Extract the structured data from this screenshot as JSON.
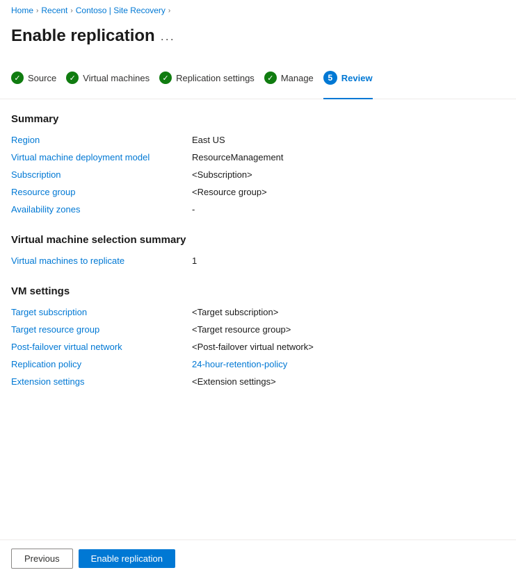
{
  "breadcrumb": {
    "items": [
      {
        "label": "Home",
        "link": true
      },
      {
        "label": "Recent",
        "link": true
      },
      {
        "label": "Contoso | Site Recovery",
        "link": true
      }
    ]
  },
  "page": {
    "title": "Enable replication",
    "dots": "..."
  },
  "steps": [
    {
      "label": "Source",
      "status": "complete",
      "num": 1
    },
    {
      "label": "Virtual machines",
      "status": "complete",
      "num": 2
    },
    {
      "label": "Replication settings",
      "status": "complete",
      "num": 3
    },
    {
      "label": "Manage",
      "status": "complete",
      "num": 4
    },
    {
      "label": "Review",
      "status": "active",
      "num": 5
    }
  ],
  "summary": {
    "title": "Summary",
    "rows": [
      {
        "label": "Region",
        "value": "East US",
        "type": "plain"
      },
      {
        "label": "Virtual machine deployment model",
        "value": "ResourceManagement",
        "type": "plain"
      },
      {
        "label": "Subscription",
        "value": "<Subscription>",
        "type": "plain"
      },
      {
        "label": "Resource group",
        "value": "<Resource group>",
        "type": "plain"
      },
      {
        "label": "Availability zones",
        "value": "-",
        "type": "plain"
      }
    ]
  },
  "vm_selection": {
    "title": "Virtual machine selection summary",
    "rows": [
      {
        "label": "Virtual machines to replicate",
        "value": "1",
        "type": "plain"
      }
    ]
  },
  "vm_settings": {
    "title": "VM settings",
    "rows": [
      {
        "label": "Target subscription",
        "value": "<Target subscription>",
        "type": "plain"
      },
      {
        "label": "Target resource group",
        "value": "<Target resource group>",
        "type": "plain"
      },
      {
        "label": "Post-failover virtual network",
        "value": "<Post-failover virtual network>",
        "type": "plain"
      },
      {
        "label": "Replication policy",
        "value": "24-hour-retention-policy",
        "type": "link"
      },
      {
        "label": "Extension settings",
        "value": "<Extension settings>",
        "type": "plain"
      }
    ]
  },
  "bottom": {
    "previous_label": "Previous",
    "enable_label": "Enable replication"
  }
}
